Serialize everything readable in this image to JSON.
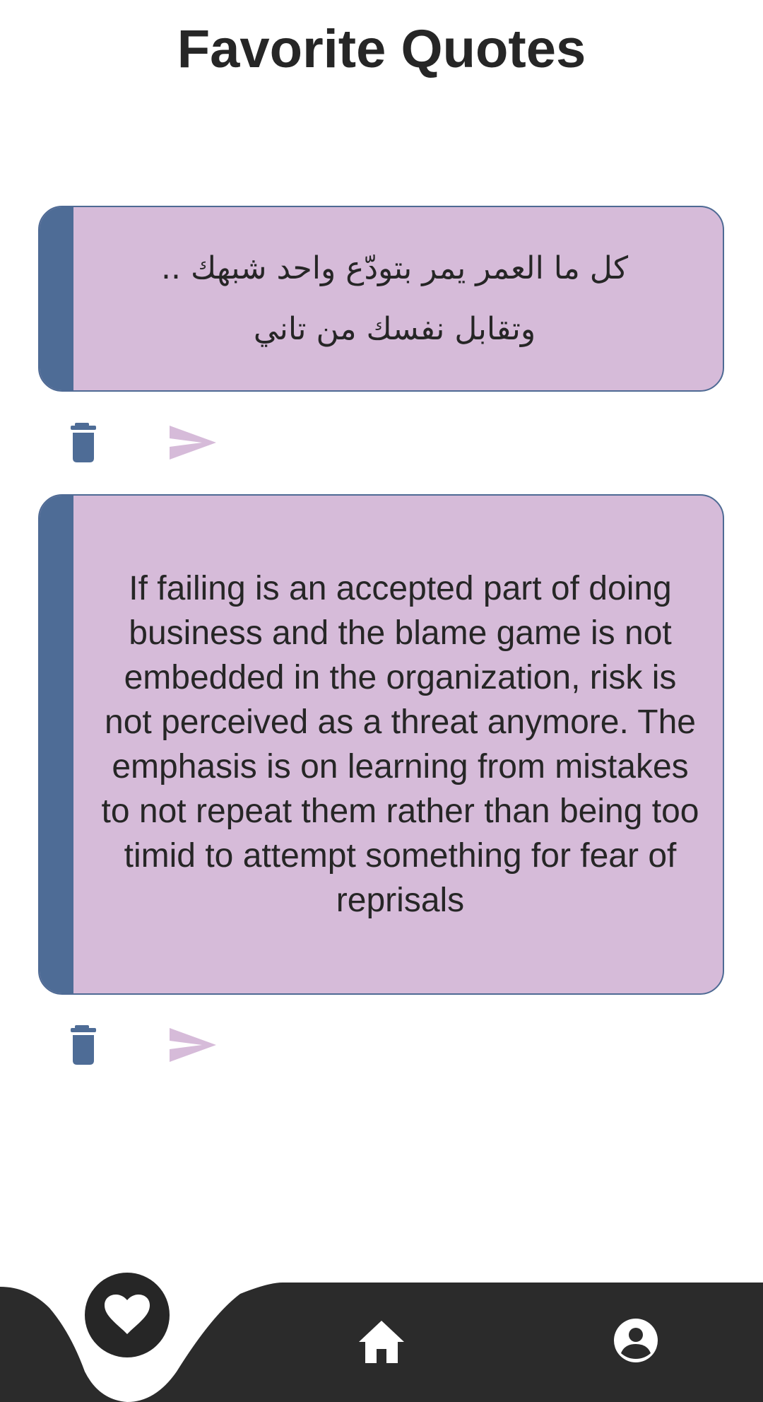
{
  "header": {
    "title": "Favorite Quotes"
  },
  "quotes": [
    {
      "text": "كل ما العمر يمر بتودّع واحد شبهك .. وتقابل نفسك من تاني"
    },
    {
      "text": "If failing is an accepted part of doing business and the blame game is not embedded in the organization, risk is not perceived as a threat anymore. The emphasis is on learning from mistakes to not repeat them rather than being too timid to attempt something for fear of reprisals"
    }
  ],
  "actions": {
    "delete_icon": "trash-icon",
    "share_icon": "send-icon"
  },
  "bottom_nav": {
    "items": [
      {
        "icon": "heart-icon",
        "active": true
      },
      {
        "icon": "home-icon",
        "active": false
      },
      {
        "icon": "account-circle-icon",
        "active": false
      }
    ]
  },
  "colors": {
    "card_background": "#d6bbd9",
    "card_accent": "#4e6c96",
    "nav_background": "#2b2b2b",
    "text": "#262626",
    "send_icon": "#d6bbd9"
  }
}
